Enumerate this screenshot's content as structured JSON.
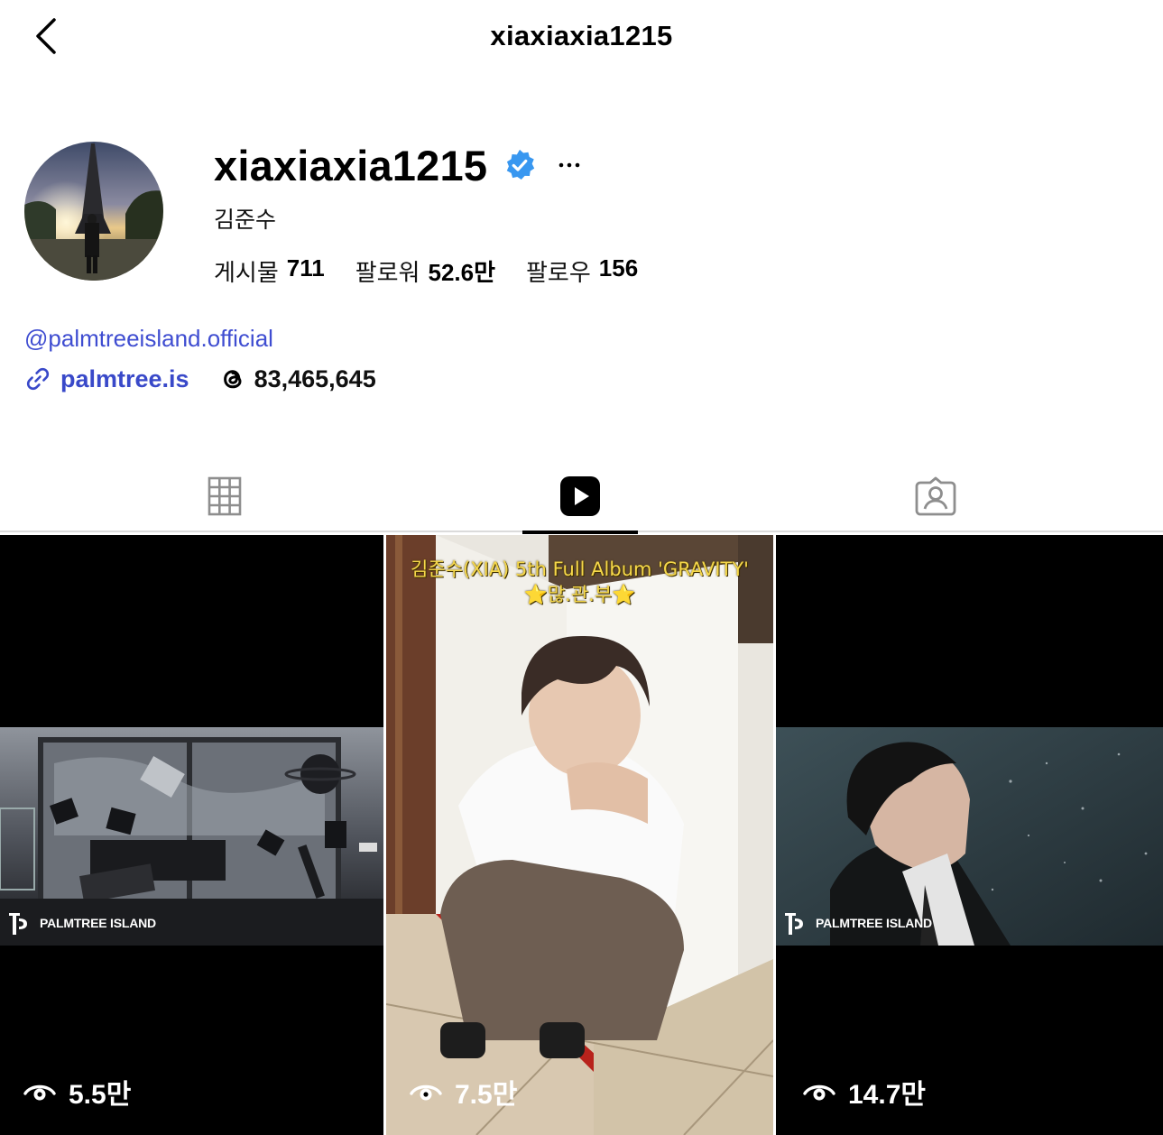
{
  "header": {
    "title": "xiaxiaxia1215"
  },
  "profile": {
    "username": "xiaxiaxia1215",
    "full_name": "김준수",
    "verified": true,
    "stats": [
      {
        "label": "게시물",
        "value": "711"
      },
      {
        "label": "팔로워",
        "value": "52.6만"
      },
      {
        "label": "팔로우",
        "value": "156"
      }
    ],
    "mention": "@palmtreeisland.official",
    "link": "palmtree.is",
    "threads_count": "83,465,645"
  },
  "tabs": [
    {
      "name": "grid",
      "icon": "grid-icon",
      "active": false
    },
    {
      "name": "reels",
      "icon": "reels-icon",
      "active": true
    },
    {
      "name": "tagged",
      "icon": "tagged-icon",
      "active": false
    }
  ],
  "reels": [
    {
      "views": "5.5만",
      "brand": "PALMTREE ISLAND",
      "caption": null
    },
    {
      "views": "7.5만",
      "brand": null,
      "caption": [
        "김준수(XIA) 5th Full Album 'GRAVITY'",
        "⭐많.관.부⭐"
      ]
    },
    {
      "views": "14.7만",
      "brand": "PALMTREE ISLAND",
      "caption": null
    }
  ],
  "colors": {
    "link": "#3949c9",
    "verified": "#3897f0",
    "caption": "#f6d84a"
  }
}
